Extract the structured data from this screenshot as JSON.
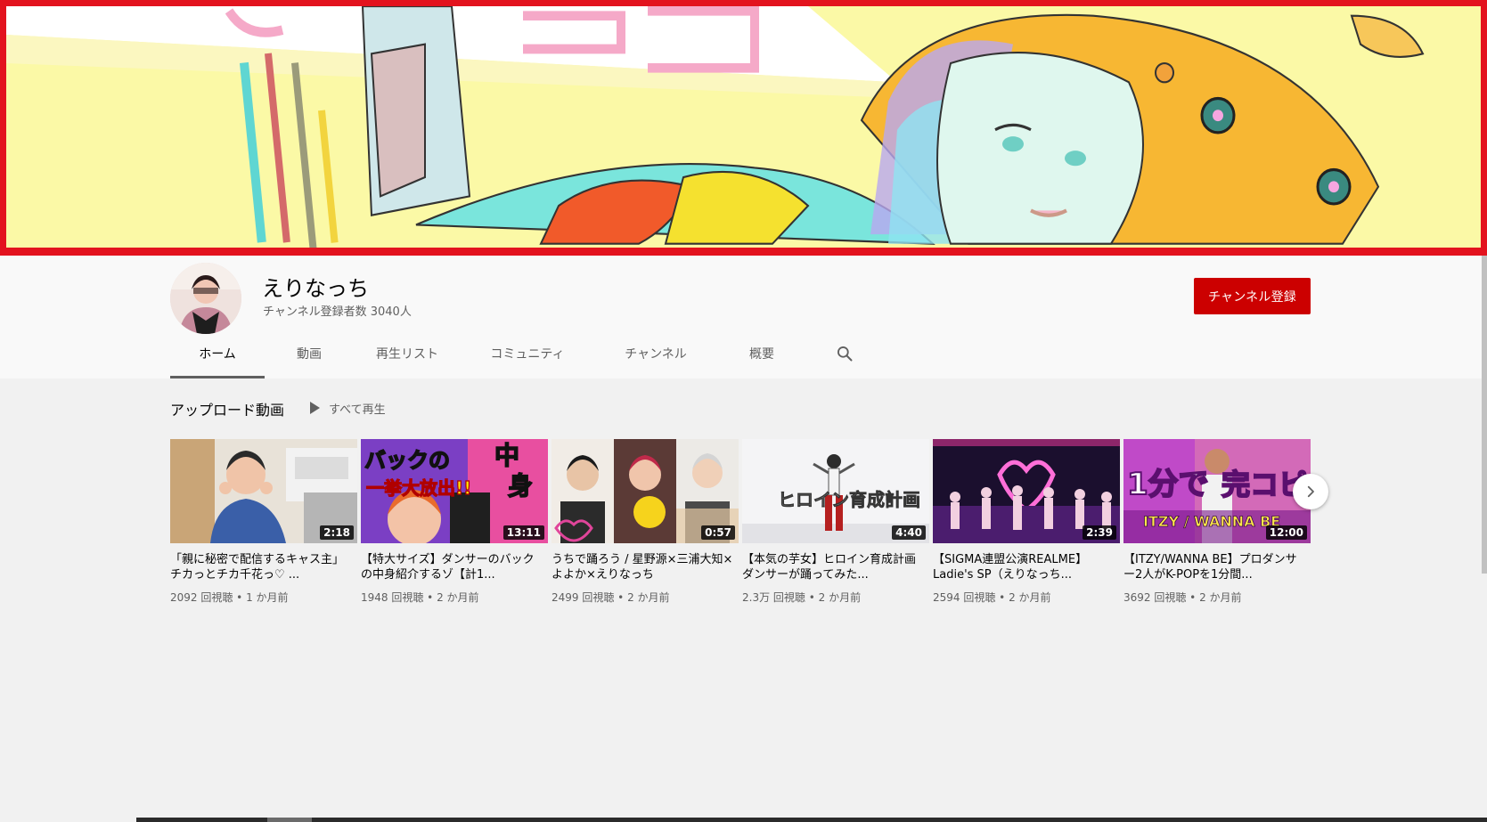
{
  "channel": {
    "name": "えりなっち",
    "subscribers": "チャンネル登録者数 3040人",
    "subscribe_label": "チャンネル登録"
  },
  "tabs": [
    {
      "label": "ホーム",
      "active": true
    },
    {
      "label": "動画"
    },
    {
      "label": "再生リスト"
    },
    {
      "label": "コミュニティ"
    },
    {
      "label": "チャンネル"
    },
    {
      "label": "概要"
    }
  ],
  "shelf": {
    "title": "アップロード動画",
    "play_all_label": "すべて再生"
  },
  "videos": [
    {
      "title": "「親に秘密で配信するキャス主」 チカっとチカ千花っ♡ ...",
      "duration": "2:18",
      "views": "2092 回視聴",
      "age": "1 か月前"
    },
    {
      "title": "【特大サイズ】ダンサーのバックの中身紹介するゾ【計1...",
      "duration": "13:11",
      "views": "1948 回視聴",
      "age": "2 か月前",
      "thumb_text_a": "バックの",
      "thumb_text_b": "中",
      "thumb_text_c": "一挙大放出!!",
      "thumb_text_d": "身"
    },
    {
      "title": "うちで踊ろう / 星野源×三浦大知×よよか×えりなっち",
      "duration": "0:57",
      "views": "2499 回視聴",
      "age": "2 か月前"
    },
    {
      "title": "【本気の芋女】ヒロイン育成計画 ダンサーが踊ってみた...",
      "duration": "4:40",
      "views": "2.3万 回視聴",
      "age": "2 か月前",
      "thumb_text_a": "ヒロイン育成計画"
    },
    {
      "title": "【SIGMA連盟公演REALME】Ladie's SP（えりなっち...",
      "duration": "2:39",
      "views": "2594 回視聴",
      "age": "2 か月前"
    },
    {
      "title": "【ITZY/WANNA BE】プロダンサー2人がK-POPを1分間...",
      "duration": "12:00",
      "views": "3692 回視聴",
      "age": "2 か月前",
      "thumb_text_a": "1分で",
      "thumb_text_b": "完コピ",
      "thumb_text_c": "ITZY / WANNA BE"
    }
  ],
  "meta_separator": " • ",
  "icons": {
    "search": "search-icon",
    "play": "play-icon",
    "next": "chevron-right-icon"
  },
  "colors": {
    "accent": "#cc0000",
    "banner_border": "#e3131e",
    "banner_yellow": "#fbf9a6"
  }
}
